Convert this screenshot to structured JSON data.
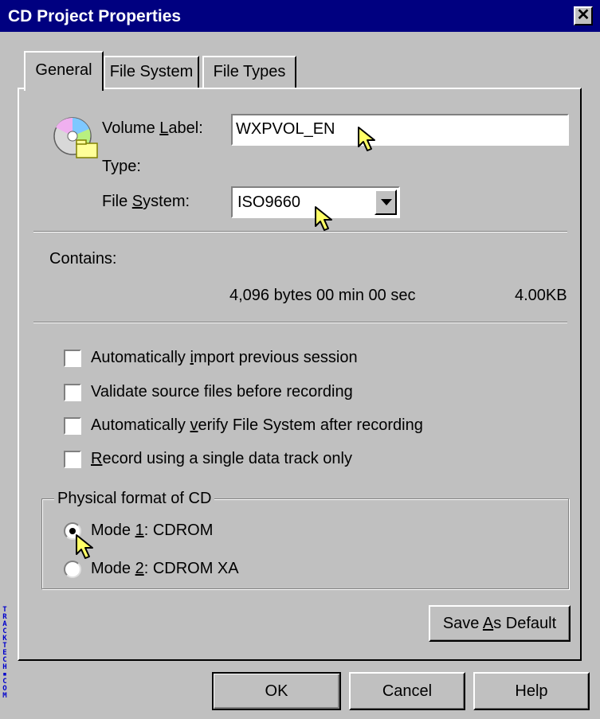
{
  "window": {
    "title": "CD Project Properties",
    "close_glyph": "✕"
  },
  "tabs": [
    {
      "label": "General",
      "active": true
    },
    {
      "label": "File System",
      "active": false
    },
    {
      "label": "File Types",
      "active": false
    }
  ],
  "general": {
    "volume_label_pre": "Volume ",
    "volume_label_key": "L",
    "volume_label_post": "abel:",
    "volume_label_value": "WXPVOL_EN",
    "type_label": "Type:",
    "file_system_pre": "File ",
    "file_system_key": "S",
    "file_system_post": "ystem:",
    "file_system_value": "ISO9660",
    "contains_label": "Contains:",
    "contains_detail": "4,096 bytes 00 min 00 sec",
    "contains_size": "4.00KB"
  },
  "options": [
    {
      "pre": "Automatically ",
      "key": "i",
      "post": "mport previous session",
      "checked": false
    },
    {
      "pre": "Validate source files before recording",
      "key": "",
      "post": "",
      "checked": false
    },
    {
      "pre": "Automatically ",
      "key": "v",
      "post": "erify File System after recording",
      "checked": false
    },
    {
      "pre": "",
      "key": "R",
      "post": "ecord using a single data track only",
      "checked": false
    }
  ],
  "physical_format": {
    "group_title": "Physical format of CD",
    "modes": [
      {
        "pre": "Mode ",
        "key": "1",
        "post": ": CDROM",
        "selected": true
      },
      {
        "pre": "Mode ",
        "key": "2",
        "post": ": CDROM XA",
        "selected": false
      }
    ]
  },
  "buttons": {
    "save_default_pre": "Save ",
    "save_default_key": "A",
    "save_default_post": "s Default",
    "ok": "OK",
    "cancel": "Cancel",
    "help": "Help"
  },
  "watermark": "TRACKTECH▪COM",
  "colors": {
    "titlebar": "#000080",
    "face": "#c0c0c0",
    "cursor_fill": "#ffff66"
  },
  "icons": {
    "cd": "cd-project-icon",
    "cursor": "arrow-pointer-cursor"
  }
}
